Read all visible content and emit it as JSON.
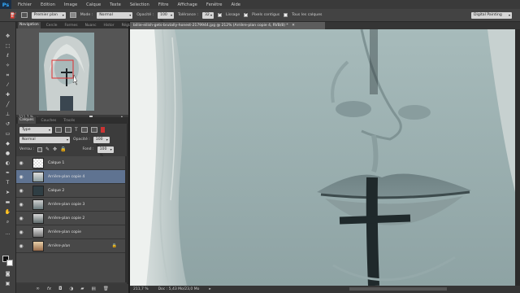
{
  "app": {
    "logo": "Ps"
  },
  "menu": [
    "Fichier",
    "Edition",
    "Image",
    "Calque",
    "Texte",
    "Sélection",
    "Filtre",
    "Affichage",
    "Fenêtre",
    "Aide"
  ],
  "options": {
    "sample_layer": "Premier plan",
    "mode_label": "Mode :",
    "mode_value": "Normal",
    "opacity_label": "Opacité :",
    "opacity_value": "100 %",
    "tolerance_label": "Tolérance :",
    "tolerance_value": "32",
    "antialias_label": "Lissage",
    "antialias_checked": true,
    "contiguous_label": "Pixels contigus",
    "contiguous_checked": true,
    "all_layers_label": "Tous les calques",
    "all_layers_checked": false,
    "workspace": "Digital Painting"
  },
  "navigator": {
    "tabs": [
      "Navigation",
      "Cercle",
      "Formes",
      "Nuanc",
      "Histor",
      "Régla"
    ],
    "zoom": "211,7 %"
  },
  "document": {
    "tab_title": "billie-eilish-gets-brutally-honest-2179944.jpg @ 212% (Arrière-plan copie 4, RVB/8) *",
    "zoom": "211,7 %",
    "doc_size": "Doc : 5,43 Mo/23,0 Mo"
  },
  "layers_panel": {
    "tabs": [
      "Calques",
      "Couches",
      "Tracés"
    ],
    "filter": "Type",
    "blend_mode": "Normal",
    "opacity_label": "Opacité :",
    "opacity_value": "100 %",
    "lock_label": "Verrou :",
    "fill_label": "Fond :",
    "fill_value": "100 %",
    "layers": [
      {
        "name": "Calque 1",
        "visible": true,
        "selected": false,
        "italic": false,
        "thumb": "transparent"
      },
      {
        "name": "Arrière-plan copie 4",
        "visible": true,
        "selected": true,
        "italic": false,
        "thumb": "face"
      },
      {
        "name": "Calque 2",
        "visible": true,
        "selected": false,
        "italic": false,
        "thumb": "dark"
      },
      {
        "name": "Arrière-plan copie 3",
        "visible": true,
        "selected": false,
        "italic": false,
        "thumb": "face"
      },
      {
        "name": "Arrière-plan copie 2",
        "visible": true,
        "selected": false,
        "italic": false,
        "thumb": "face"
      },
      {
        "name": "Arrière-plan copie",
        "visible": true,
        "selected": false,
        "italic": false,
        "thumb": "face"
      },
      {
        "name": "Arrière-plan",
        "visible": true,
        "selected": false,
        "italic": true,
        "thumb": "color",
        "locked": true
      }
    ],
    "footer_icons": [
      "link-icon",
      "fx-icon",
      "mask-icon",
      "adjustment-icon",
      "group-icon",
      "new-layer-icon",
      "trash-icon"
    ]
  },
  "colors": {
    "foreground": "#101010",
    "background": "#ffffff",
    "selected_layer": "#5f7391",
    "canvas_tint": "#9cb1b2"
  }
}
